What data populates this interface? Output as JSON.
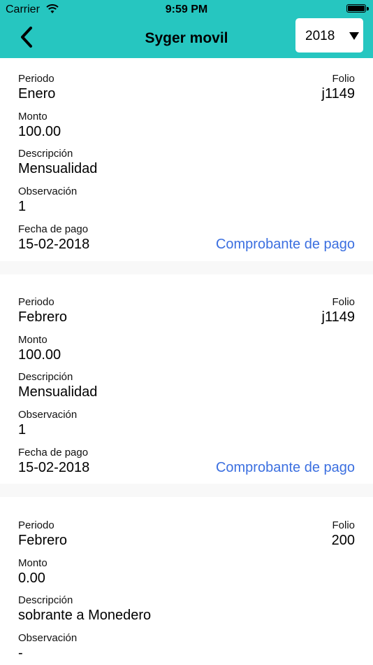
{
  "status_bar": {
    "carrier": "Carrier",
    "time": "9:59 PM"
  },
  "header": {
    "title": "Syger movil",
    "year_selected": "2018"
  },
  "labels": {
    "periodo": "Periodo",
    "folio": "Folio",
    "monto": "Monto",
    "descripcion": "Descripción",
    "observacion": "Observación",
    "fecha_pago": "Fecha de pago",
    "comprobante": "Comprobante de pago"
  },
  "payments": [
    {
      "periodo": "Enero",
      "folio": "j1149",
      "monto": "100.00",
      "descripcion": "Mensualidad",
      "observacion": "1",
      "fecha_pago": "15-02-2018"
    },
    {
      "periodo": "Febrero",
      "folio": "j1149",
      "monto": "100.00",
      "descripcion": "Mensualidad",
      "observacion": "1",
      "fecha_pago": "15-02-2018"
    },
    {
      "periodo": "Febrero",
      "folio": "200",
      "monto": "0.00",
      "descripcion": "sobrante a Monedero",
      "observacion": "-"
    }
  ]
}
